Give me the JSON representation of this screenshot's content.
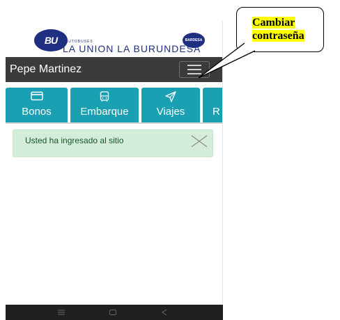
{
  "logo": {
    "left_badge": "BU",
    "small_text": "AUTOBUSES",
    "company_name": "LA UNION LA BURUNDESA",
    "right_badge": "BARDESA"
  },
  "header": {
    "user_name": "Pepe Martinez",
    "menu_icon": "hamburger-icon"
  },
  "tabs": [
    {
      "label": "Bonos",
      "icon": "card-icon"
    },
    {
      "label": "Embarque",
      "icon": "bus-icon"
    },
    {
      "label": "Viajes",
      "icon": "send-icon"
    },
    {
      "label": "R",
      "icon": ""
    }
  ],
  "alert": {
    "message": "Usted ha ingresado al sitio",
    "close_icon": "close-icon"
  },
  "android_nav": {
    "icons": [
      "menu-icon",
      "home-icon",
      "back-icon"
    ]
  },
  "callout": {
    "line1": "Cambiar",
    "line2": "contraseña"
  },
  "colors": {
    "tab_bg": "#1a9fb3",
    "header_bg": "#3b3b3b",
    "alert_bg": "#d4eddb",
    "brand_blue": "#1f2f82",
    "highlight": "#ffff00"
  }
}
